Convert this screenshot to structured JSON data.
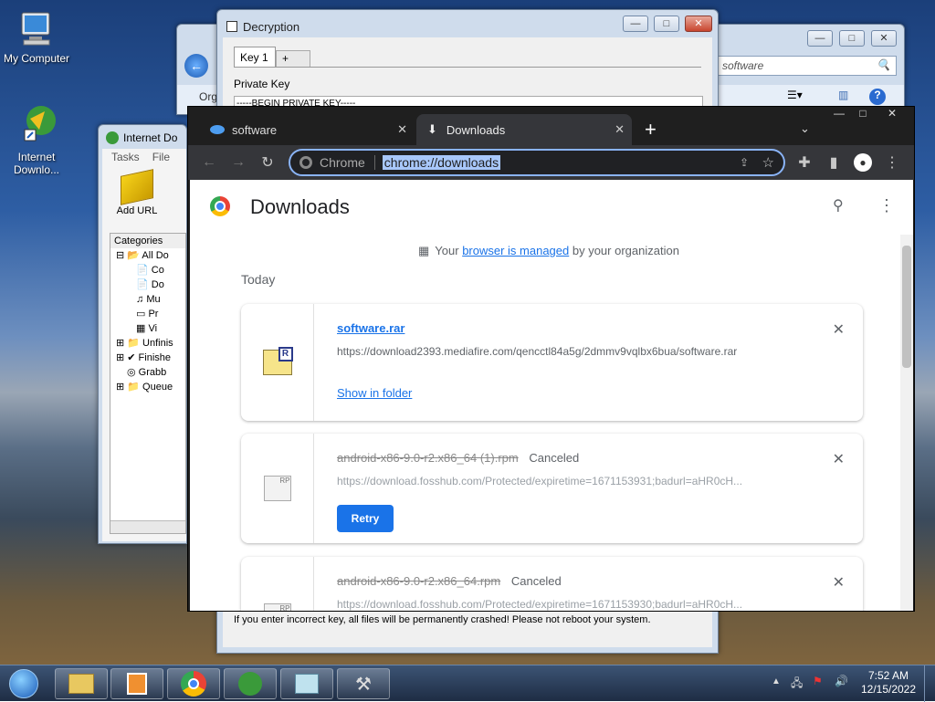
{
  "desktop": {
    "icons": [
      {
        "label": "My Computer"
      },
      {
        "label": "Internet Downlo..."
      }
    ]
  },
  "decryption": {
    "title": "Decryption",
    "tab1": "Key 1",
    "tab_add": "+",
    "private_key_label": "Private Key",
    "key_line": "-----BEGIN PRIVATE KEY-----",
    "warning": "If you enter incorrect key, all files will be permanently crashed! Please not reboot your system."
  },
  "explorer": {
    "search_text": "software",
    "org_label": "Org"
  },
  "idm": {
    "title": "Internet Do",
    "menu": [
      "Tasks",
      "File"
    ],
    "add_url": "Add URL",
    "categories_header": "Categories",
    "tree": [
      "All Do",
      "Co",
      "Do",
      "Mu",
      "Pr",
      "Vi",
      "Unfinis",
      "Finishe",
      "Grabb",
      "Queue"
    ]
  },
  "chrome": {
    "tabs": [
      {
        "title": "software"
      },
      {
        "title": "Downloads"
      }
    ],
    "new_tab": "+",
    "omnibox": {
      "chip": "Chrome",
      "url": "chrome://downloads"
    },
    "page_title": "Downloads",
    "managed": {
      "prefix": "Your ",
      "link": "browser is managed",
      "suffix": " by your organization"
    },
    "section": "Today",
    "items": [
      {
        "name": "software.rar",
        "status": "",
        "url": "https://download2393.mediafire.com/qencctl84a5g/2dmmv9vqlbx6bua/software.rar",
        "action": "Show in folder"
      },
      {
        "name": "android-x86-9.0-r2.x86_64 (1).rpm",
        "status": "Canceled",
        "url": "https://download.fosshub.com/Protected/expiretime=1671153931;badurl=aHR0cH...",
        "action": "Retry"
      },
      {
        "name": "android-x86-9.0-r2.x86_64.rpm",
        "status": "Canceled",
        "url": "https://download.fosshub.com/Protected/expiretime=1671153930;badurl=aHR0cH...",
        "action": ""
      }
    ]
  },
  "taskbar": {
    "time": "7:52 AM",
    "date": "12/15/2022"
  },
  "colors": {
    "accent": "#1a73e8",
    "chrome_dark": "#202124"
  }
}
